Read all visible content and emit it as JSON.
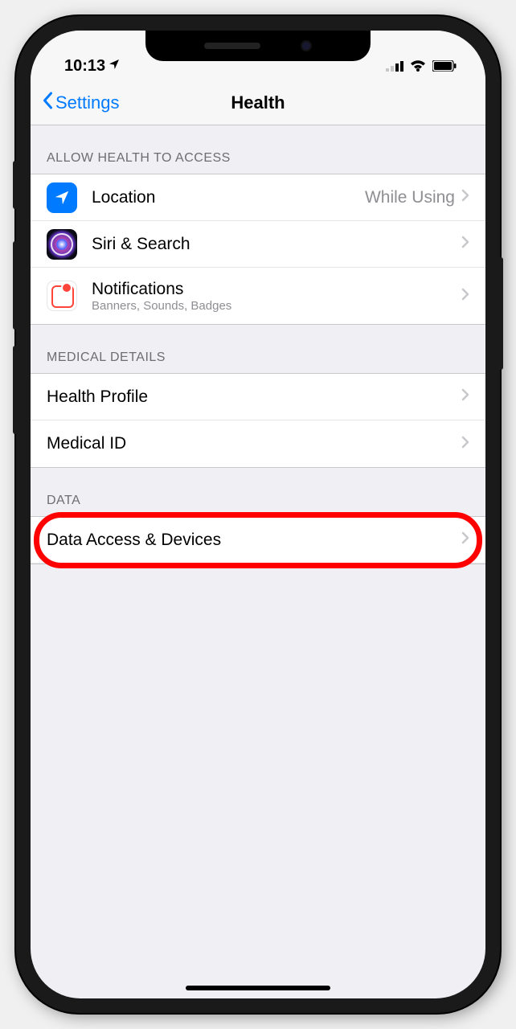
{
  "status_bar": {
    "time": "10:13"
  },
  "nav": {
    "back": "Settings",
    "title": "Health"
  },
  "sections": {
    "access": {
      "header": "ALLOW HEALTH TO ACCESS",
      "location": {
        "label": "Location",
        "value": "While Using"
      },
      "siri": {
        "label": "Siri & Search"
      },
      "notifications": {
        "label": "Notifications",
        "sub": "Banners, Sounds, Badges"
      }
    },
    "medical": {
      "header": "MEDICAL DETAILS",
      "profile": {
        "label": "Health Profile"
      },
      "medical_id": {
        "label": "Medical ID"
      }
    },
    "data": {
      "header": "DATA",
      "dad": {
        "label": "Data Access & Devices"
      }
    }
  }
}
